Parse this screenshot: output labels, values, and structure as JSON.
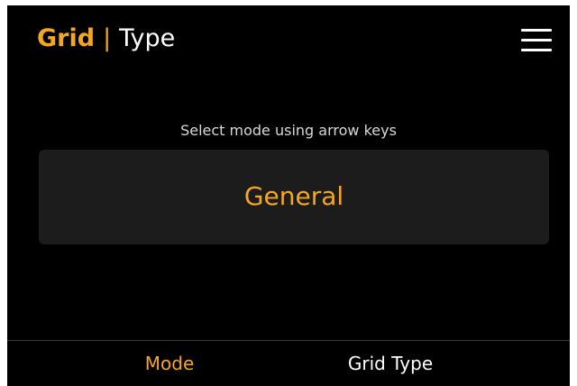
{
  "header": {
    "title_primary": "Grid",
    "separator": "|",
    "title_secondary": "Type",
    "menu_icon": "hamburger-menu-icon"
  },
  "main": {
    "hint": "Select mode using arrow keys",
    "selected_mode": "General"
  },
  "footer": {
    "tabs": [
      {
        "label": "Mode",
        "active": true
      },
      {
        "label": "Grid Type",
        "active": false
      }
    ]
  },
  "colors": {
    "accent": "#f5a623",
    "background": "#000000",
    "panel": "#1c1c1c",
    "text": "#ffffff"
  }
}
